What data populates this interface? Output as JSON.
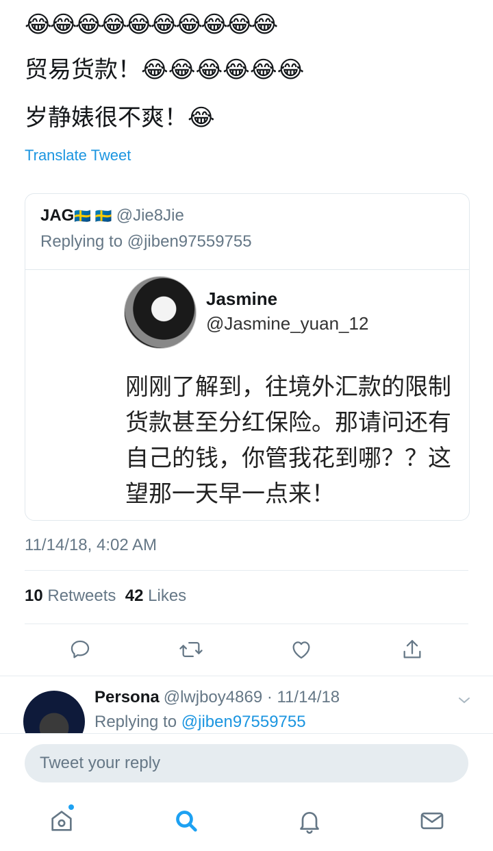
{
  "tweet": {
    "line1": "😂😂😂😂😂😂😂😂😂😂",
    "line2": "贸易货款！😂😂😂😂😂😂",
    "line3": "岁静婊很不爽！😂",
    "translate_label": "Translate Tweet",
    "timestamp": "11/14/18, 4:02 AM"
  },
  "quoted": {
    "name": "JAG",
    "flags": "🇸🇪 🇸🇪",
    "handle": "@Jie8Jie",
    "replying_to": "Replying to @jiben97559755",
    "embedded": {
      "name": "Jasmine",
      "handle": "@Jasmine_yuan_12",
      "lines": [
        "刚刚了解到，往境外汇款的限制",
        "货款甚至分红保险。那请问还有",
        "自己的钱，你管我花到哪？？这",
        "望那一天早一点来！"
      ]
    }
  },
  "stats": {
    "retweets_count": "10",
    "retweets_label": "Retweets",
    "likes_count": "42",
    "likes_label": "Likes"
  },
  "reply": {
    "name": "Persona",
    "handle_date": "@lwjboy4869 · 11/14/18",
    "replying_prefix": "Replying to",
    "replying_handle": "@jiben97559755"
  },
  "composer": {
    "placeholder": "Tweet your reply"
  },
  "colors": {
    "accent": "#1da1f2",
    "link": "#1b95e0",
    "muted": "#657786"
  },
  "icons": [
    "reply-icon",
    "retweet-icon",
    "like-icon",
    "share-icon",
    "chevron-down-icon",
    "home-icon",
    "search-icon",
    "notifications-icon",
    "messages-icon"
  ]
}
